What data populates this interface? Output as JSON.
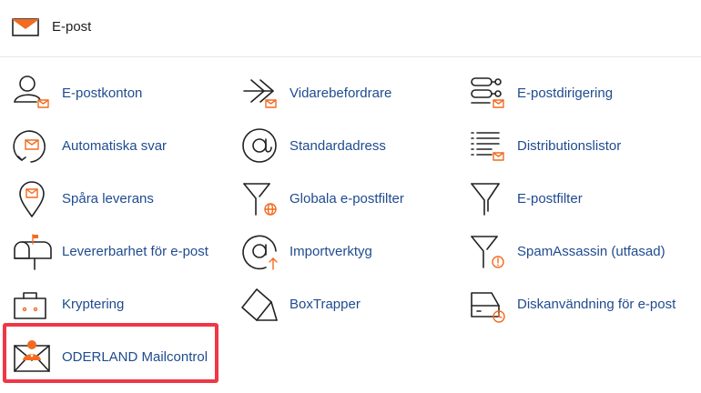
{
  "header": {
    "title": "E-post",
    "icon": "envelope-icon"
  },
  "colors": {
    "link": "#1f4b8f",
    "accent": "#f26b21",
    "highlight": "#ee3747"
  },
  "items": [
    {
      "label": "E-postkonton",
      "icon": "user-mail-icon"
    },
    {
      "label": "Vidarebefordrare",
      "icon": "forward-mail-icon"
    },
    {
      "label": "E-postdirigering",
      "icon": "routing-icon"
    },
    {
      "label": "Automatiska svar",
      "icon": "auto-reply-icon"
    },
    {
      "label": "Standardadress",
      "icon": "at-sign-icon"
    },
    {
      "label": "Distributionslistor",
      "icon": "list-mail-icon"
    },
    {
      "label": "Spåra leverans",
      "icon": "location-pin-icon"
    },
    {
      "label": "Globala e-postfilter",
      "icon": "global-filter-icon"
    },
    {
      "label": "E-postfilter",
      "icon": "filter-icon"
    },
    {
      "label": "Levererbarhet för e-post",
      "icon": "mailbox-icon"
    },
    {
      "label": "Importverktyg",
      "icon": "import-icon"
    },
    {
      "label": "SpamAssassin (utfasad)",
      "icon": "spam-filter-icon"
    },
    {
      "label": "Kryptering",
      "icon": "lock-icon"
    },
    {
      "label": "BoxTrapper",
      "icon": "box-trapper-icon"
    },
    {
      "label": "Diskanvändning för e-post",
      "icon": "disk-usage-icon"
    },
    {
      "label": "ODERLAND Mailcontrol",
      "icon": "mailcontrol-icon"
    }
  ]
}
